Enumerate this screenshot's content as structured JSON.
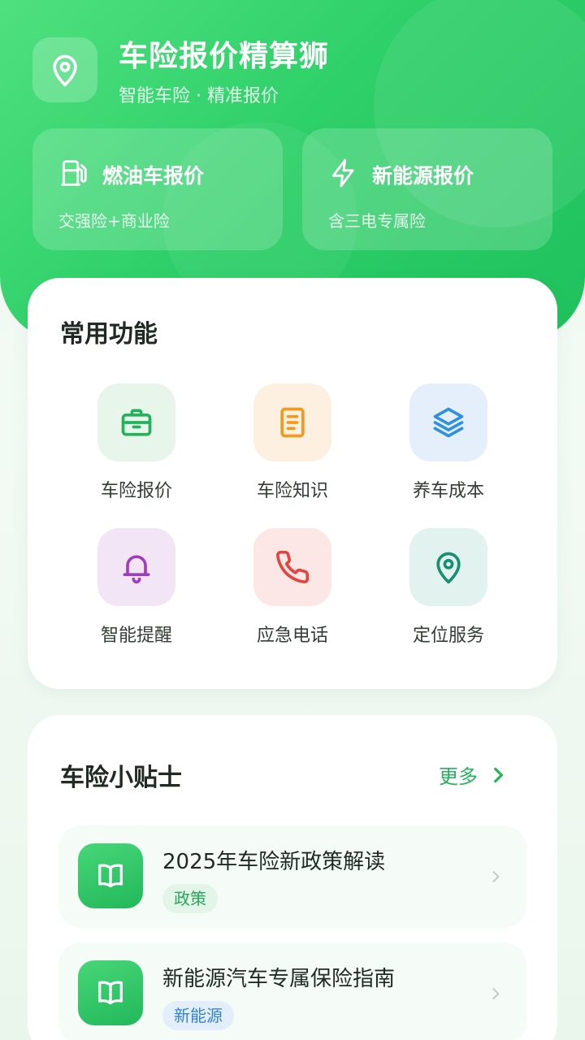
{
  "header": {
    "app_title": "车险报价精算狮",
    "app_subtitle": "智能车险 · 精准报价",
    "logo_icon": "location-pin-icon",
    "quotes": [
      {
        "title": "燃油车报价",
        "subtitle": "交强险+商业险",
        "icon": "fuel-pump-icon"
      },
      {
        "title": "新能源报价",
        "subtitle": "含三电专属险",
        "icon": "lightning-icon"
      }
    ]
  },
  "functions": {
    "title": "常用功能",
    "items": [
      {
        "label": "车险报价",
        "icon": "briefcase-icon",
        "color": "#22b35a"
      },
      {
        "label": "车险知识",
        "icon": "document-icon",
        "color": "#f29a1d"
      },
      {
        "label": "养车成本",
        "icon": "layers-icon",
        "color": "#2f8fe0"
      },
      {
        "label": "智能提醒",
        "icon": "bell-icon",
        "color": "#a03cc0"
      },
      {
        "label": "应急电话",
        "icon": "phone-icon",
        "color": "#e0463f"
      },
      {
        "label": "定位服务",
        "icon": "map-pin-icon",
        "color": "#168f73"
      }
    ]
  },
  "tips": {
    "title": "车险小贴士",
    "more_label": "更多",
    "items": [
      {
        "title": "2025年车险新政策解读",
        "tag": "政策",
        "tag_color": "#27a85a"
      },
      {
        "title": "新能源汽车专属保险指南",
        "tag": "新能源",
        "tag_color": "#2f84d6"
      }
    ]
  },
  "colors": {
    "brand_green": "#2fd06a",
    "accent_green": "#27b35d"
  }
}
